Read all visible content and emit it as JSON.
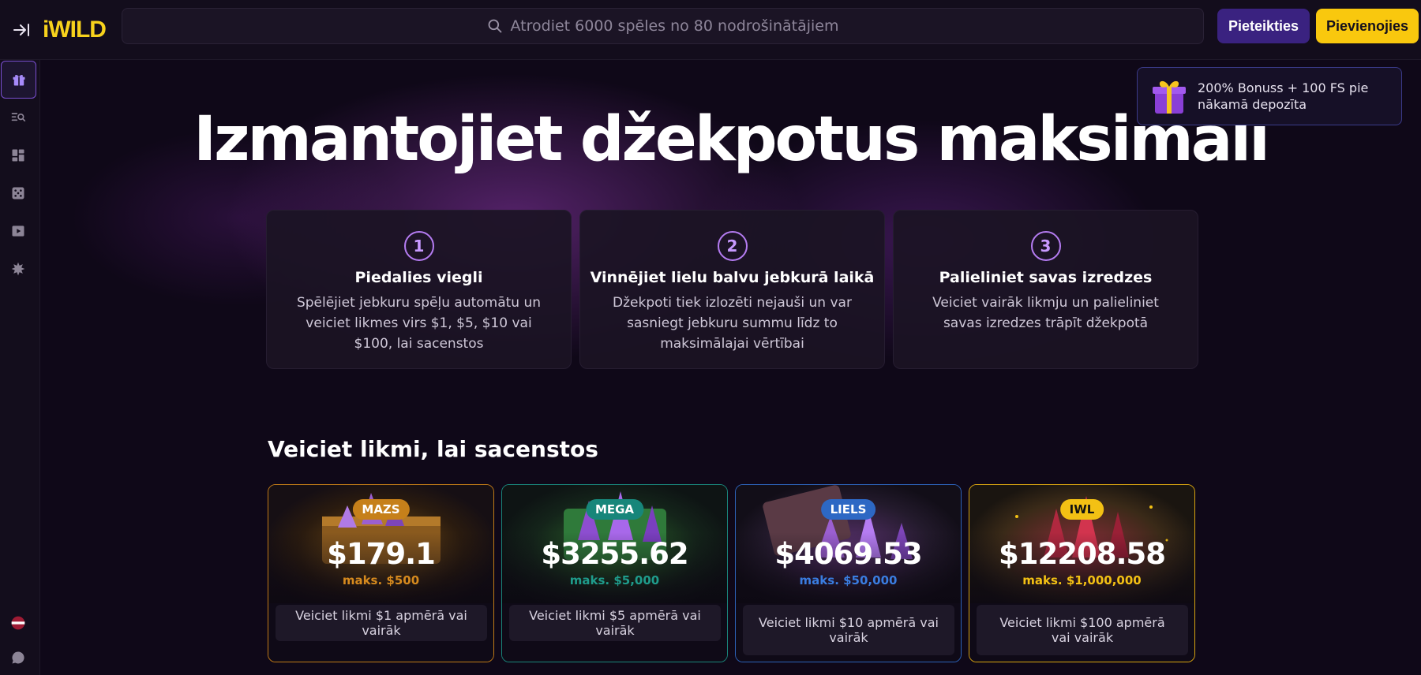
{
  "header": {
    "logo": "iWILD",
    "search_placeholder": "Atrodiet 6000 spēles no 80 nodrošinātājiem",
    "login_label": "Pieteikties",
    "join_label": "Pievienojies"
  },
  "sidebar": {
    "items": [
      {
        "icon": "gift-icon",
        "active": true
      },
      {
        "icon": "search-list-icon"
      },
      {
        "icon": "dashboard-icon"
      },
      {
        "icon": "dice-icon"
      },
      {
        "icon": "play-icon"
      },
      {
        "icon": "burst-icon"
      }
    ],
    "bottom": [
      {
        "icon": "latvia-flag-icon"
      },
      {
        "icon": "chat-icon"
      }
    ]
  },
  "promo": {
    "text": "200% Bonuss + 100 FS pie nākamā depozīta"
  },
  "hero": {
    "title": "Izmantojiet džekpotus maksimāli",
    "steps": [
      {
        "num": "1",
        "title": "Piedalies viegli",
        "text": "Spēlējiet jebkuru spēļu automātu un veiciet likmes virs $1, $5, $10 vai $100, lai sacenstos"
      },
      {
        "num": "2",
        "title": "Vinnējiet lielu balvu jebkurā laikā",
        "text": "Džekpoti tiek izlozēti nejauši un var sasniegt jebkuru summu līdz to maksimālajai vērtībai"
      },
      {
        "num": "3",
        "title": "Palieliniet savas izredzes",
        "text": "Veiciet vairāk likmju un palieliniet savas izredzes trāpīt džekpotā"
      }
    ]
  },
  "competition": {
    "title": "Veiciet likmi, lai sacenstos",
    "cards": [
      {
        "badge": "MAZS",
        "amount": "$179.1",
        "max": "maks. $500",
        "bet": "Veiciet likmi $1 apmērā vai vairāk"
      },
      {
        "badge": "MEGA",
        "amount": "$3255.62",
        "max": "maks. $5,000",
        "bet": "Veiciet likmi $5 apmērā vai vairāk"
      },
      {
        "badge": "LIELS",
        "amount": "$4069.53",
        "max": "maks. $50,000",
        "bet": "Veiciet likmi $10 apmērā vai vairāk"
      },
      {
        "badge": "IWL",
        "amount": "$12208.58",
        "max": "maks. $1,000,000",
        "bet": "Veiciet likmi $100 apmērā vai vairāk"
      }
    ]
  },
  "colors": {
    "accent_purple": "#3a2280",
    "accent_yellow": "#f9c80e",
    "mazs": "#c6801a",
    "mega": "#17867a",
    "liels": "#2d68c4",
    "iwl": "#f3c114"
  }
}
